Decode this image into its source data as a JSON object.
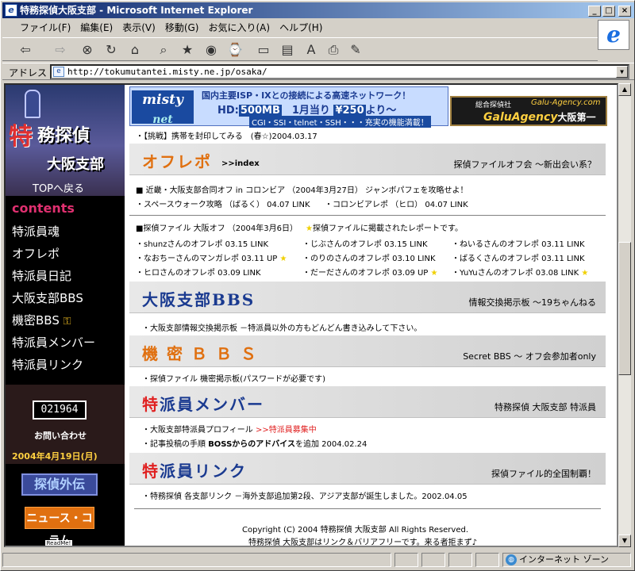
{
  "window": {
    "title": "特務探偵大阪支部 - Microsoft Internet Explorer"
  },
  "menu": [
    "ファイル(F)",
    "編集(E)",
    "表示(V)",
    "移動(G)",
    "お気に入り(A)",
    "ヘルプ(H)"
  ],
  "address": {
    "label": "アドレス",
    "url": "http://tokumutantei.misty.ne.jp/osaka/"
  },
  "status": {
    "zone": "インターネット ゾーン"
  },
  "sidebar": {
    "logo_kanji_red": "特",
    "logo_kanji_top": "務探偵",
    "logo_kanji_bottom": "大阪支部",
    "top_link": "TOPへ戻る",
    "contents_label": "contents",
    "nav": [
      "特派員魂",
      "オフレポ",
      "特派員日記",
      "大阪支部BBS",
      "機密BBS",
      "特派員メンバー",
      "特派員リンク"
    ],
    "counter": "021964",
    "contact": "お問い合わせ",
    "date": "2004年4月19日(月)",
    "btn_tantei": "探偵外伝",
    "btn_news": "ニュース・コラム",
    "readme": "ReadMe!"
  },
  "banner_misty": {
    "logo": "misty",
    "logo2": "net",
    "text_top": "国内主要ISP・IXとの接続による高速ネットワーク！",
    "hd_label": "HD:",
    "hd_value": "500MB",
    "price_label": "1月当り",
    "price": "¥250",
    "price_suffix": "より～",
    "services": "CGI・SSI・telnet・SSH・・・充実の機能満載！"
  },
  "banner_galu": {
    "small": "総合探偵社",
    "url": "Galu-Agency.com",
    "name": "GaluAgency",
    "osaka": "大阪第一"
  },
  "main": {
    "top_item": "・【挑戦】携帯を封印してみる　(春☆)2004.03.17",
    "offrepo": {
      "title": "オフレポ",
      "index": ">>index",
      "right": "探偵ファイルオフ会 ～新出会い系？"
    },
    "offrepo_l1": "■ 近畿・大阪支部合同オフ in コロンビア （2004年3月27日） ジャンボパフェを攻略せよ！",
    "offrepo_l2a": "・スペースウォーク攻略 （ばるく） 04.07 LINK",
    "offrepo_l2b": "・コロンビアレポ （ヒロ） 04.07 LINK",
    "offrepo_l3a": "■探偵ファイル 大阪オフ （2004年3月6日）",
    "offrepo_l3b": "探偵ファイルに掲載されたレポートです。",
    "grid": [
      [
        "・shunzさんのオフレポ 03.15 LINK",
        "・じぶさんのオフレポ 03.15 LINK",
        "・ねいるさんのオフレポ 03.11 LINK"
      ],
      [
        "・なおちーさんのマンガレポ 03.11 UP",
        "・のりのさんのオフレポ 03.10 LINK",
        "・ばるくさんのオフレポ 03.11 LINK"
      ],
      [
        "・ヒロさんのオフレポ 03.09 LINK",
        "・だーださんのオフレポ 03.09 UP",
        "・YuYuさんのオフレポ 03.08 LINK"
      ]
    ],
    "bbs": {
      "title": "大阪支部BBS",
      "right": "情報交換掲示板 ～19ちゃんねる",
      "line": "・大阪支部情報交換掲示板 －特派員以外の方もどんどん書き込みして下さい。"
    },
    "kimitsu": {
      "title": "機 密 Ｂ Ｂ Ｓ",
      "right": "Secret BBS ～ オフ会参加者only",
      "line": "・探偵ファイル 機密掲示板(パスワードが必要です)"
    },
    "member": {
      "title_red": "特",
      "title_rest": "派員メンバー",
      "right": "特務探偵 大阪支部 特派員",
      "l1": "・大阪支部特派員プロフィール",
      "l1_link": ">>特派員募集中",
      "l2": "・記事投稿の手順",
      "l2_bold": "BOSSからのアドバイス",
      "l2_tail": "を追加 2004.02.24"
    },
    "links": {
      "title_red": "特",
      "title_rest": "派員リンク",
      "right": "探偵ファイル的全国制覇！",
      "line": "・特務探偵 各支部リンク －海外支部追加第2段、アジア支部が誕生しました。2002.04.05"
    },
    "footer1": "Copyright (C) 2004 特務探偵 大阪支部 All Rights Reserved.",
    "footer2": "特務探偵 大阪支部はリンク＆バリアフリーです。来る者拒まず♪"
  }
}
